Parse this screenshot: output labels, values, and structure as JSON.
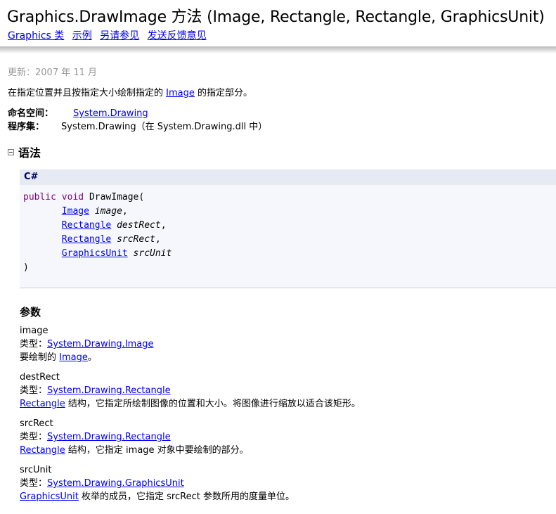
{
  "header": {
    "title_class": "Graphics.DrawImage",
    "title_kind": "方法",
    "title_signature": "(Image, Rectangle, Rectangle, GraphicsUnit)",
    "nav_links": [
      {
        "label": "Graphics 类"
      },
      {
        "label": "示例"
      },
      {
        "label": "另请参见"
      },
      {
        "label": "发送反馈意见"
      }
    ]
  },
  "updated": "更新：2007 年 11 月",
  "summary": {
    "prefix": "在指定位置并且按指定大小绘制指定的",
    "link": "Image",
    "suffix": "的指定部分。"
  },
  "namespace": {
    "label": "命名空间：",
    "value": "System.Drawing"
  },
  "assembly": {
    "label": "程序集：",
    "value": "System.Drawing（在 System.Drawing.dll 中）"
  },
  "syntax": {
    "heading": "语法",
    "language": "C#",
    "keyword_public": "public",
    "keyword_void": "void",
    "method": "DrawImage(",
    "params": [
      {
        "type": "Image",
        "name": "image",
        "sep": ","
      },
      {
        "type": "Rectangle",
        "name": "destRect",
        "sep": ","
      },
      {
        "type": "Rectangle",
        "name": "srcRect",
        "sep": ","
      },
      {
        "type": "GraphicsUnit",
        "name": "srcUnit",
        "sep": ""
      }
    ],
    "close": ")"
  },
  "parameters": {
    "heading": "参数",
    "type_label": "类型：",
    "items": [
      {
        "name": "image",
        "type_link": "System.Drawing.Image",
        "desc_prefix": "要绘制的",
        "desc_link": "Image",
        "desc_suffix": "。"
      },
      {
        "name": "destRect",
        "type_link": "System.Drawing.Rectangle",
        "desc_prefix": "",
        "desc_link": "Rectangle",
        "desc_suffix": "结构，它指定所绘制图像的位置和大小。将图像进行缩放以适合该矩形。"
      },
      {
        "name": "srcRect",
        "type_link": "System.Drawing.Rectangle",
        "desc_prefix": "",
        "desc_link": "Rectangle",
        "desc_suffix": "结构，它指定 image 对象中要绘制的部分。"
      },
      {
        "name": "srcUnit",
        "type_link": "System.Drawing.GraphicsUnit",
        "desc_prefix": "",
        "desc_link": "GraphicsUnit",
        "desc_suffix": "枚举的成员，它指定 srcRect 参数所用的度量单位。"
      }
    ]
  }
}
